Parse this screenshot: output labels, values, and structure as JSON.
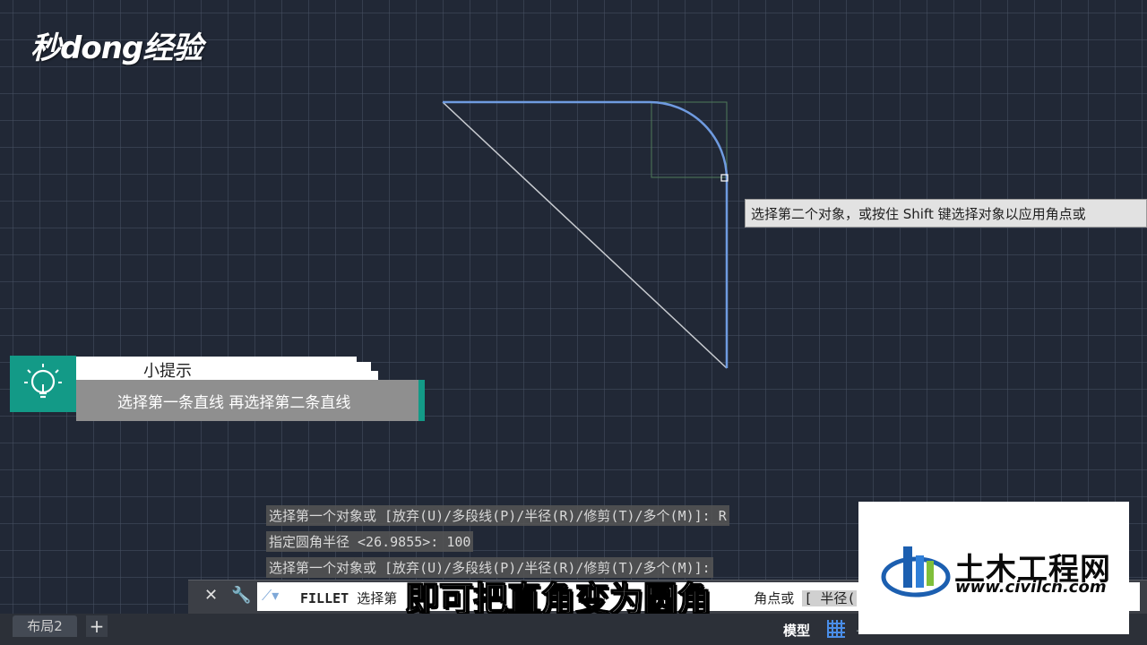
{
  "watermark_logo": "秒dong经验",
  "tooltip_text": "选择第二个对象，或按住 Shift 键选择对象以应用角点或",
  "tip": {
    "title": "小提示",
    "body": "选择第一条直线 再选择第二条直线"
  },
  "command_history": [
    "选择第一个对象或 [放弃(U)/多段线(P)/半径(R)/修剪(T)/多个(M)]: R",
    "指定圆角半径 <26.9855>: 100",
    "选择第一个对象或 [放弃(U)/多段线(P)/半径(R)/修剪(T)/多个(M)]:"
  ],
  "command_line": {
    "command": "FILLET",
    "prompt_start": "选择第",
    "prompt_end": "角点或",
    "option": "[ 半径("
  },
  "subtitle": "即可把直角变为圆角",
  "layout_tab": "布局2",
  "add_tab": "+",
  "status": {
    "model": "模型",
    "dots": "...."
  },
  "site_logo": {
    "name": "土木工程网",
    "url": "www.civilcn.com"
  },
  "icons": {
    "close": "close-icon",
    "settings": "wrench-icon",
    "command": "command-icon",
    "tip": "lightbulb-icon"
  },
  "colors": {
    "canvas": "#212836",
    "selected_line": "#6f9be0",
    "accent": "#139a87"
  }
}
